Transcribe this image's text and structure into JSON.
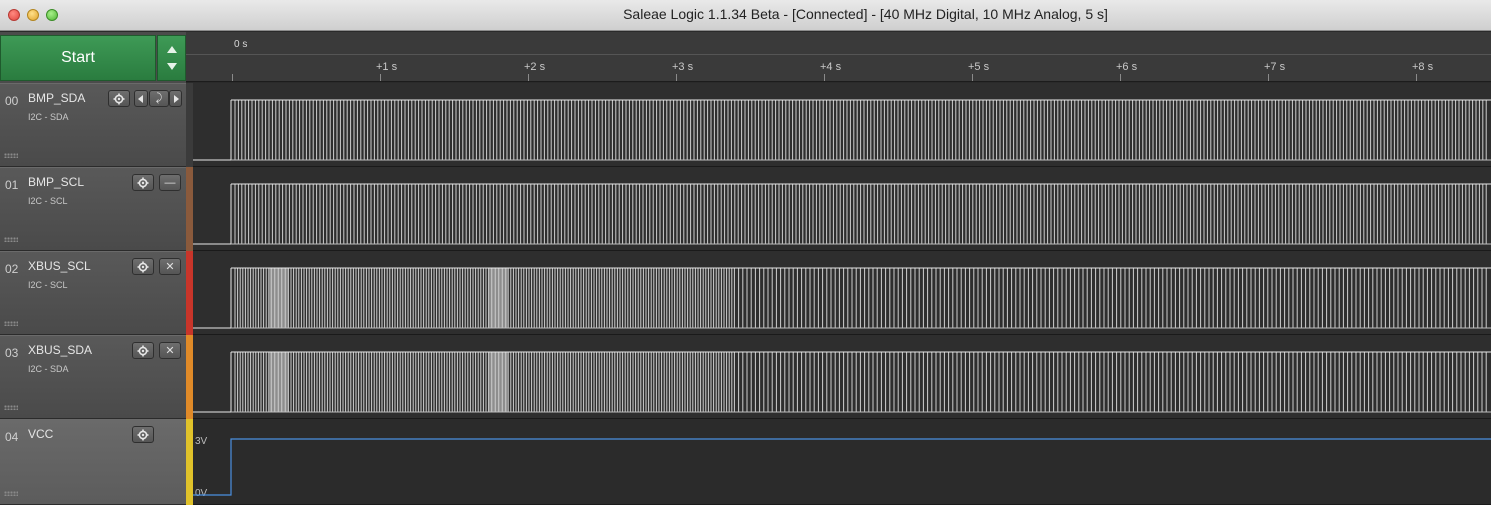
{
  "window": {
    "title": "Saleae Logic 1.1.34 Beta - [Connected] - [40 MHz Digital, 10 MHz Analog, 5 s]"
  },
  "controls": {
    "start_label": "Start"
  },
  "timeline": {
    "origin_label": "0 s",
    "ticks": [
      "+1 s",
      "+2 s",
      "+3 s",
      "+4 s",
      "+5 s",
      "+6 s",
      "+7 s",
      "+8 s"
    ]
  },
  "channels": [
    {
      "num": "00",
      "name": "BMP_SDA",
      "analyzer": "I2C - SDA",
      "color": "#3b3b3b"
    },
    {
      "num": "01",
      "name": "BMP_SCL",
      "analyzer": "I2C - SCL",
      "color": "#8a5a3c"
    },
    {
      "num": "02",
      "name": "XBUS_SCL",
      "analyzer": "I2C - SCL",
      "color": "#c8352a"
    },
    {
      "num": "03",
      "name": "XBUS_SDA",
      "analyzer": "I2C - SDA",
      "color": "#e08a28"
    },
    {
      "num": "04",
      "name": "VCC",
      "analyzer": "",
      "color": "#e0c22a"
    }
  ],
  "analog": {
    "high_label": "3V",
    "low_label": "0V",
    "trace_color": "#4a8fe0"
  },
  "icons": {
    "settings": "gear-icon",
    "prev": "chevron-left-icon",
    "edge": "falling-edge-icon",
    "next": "chevron-right-icon",
    "collapse": "minus-icon",
    "close": "close-icon"
  },
  "edge_glyph": "⤸",
  "close_glyph": "✕",
  "minus_glyph": "—"
}
